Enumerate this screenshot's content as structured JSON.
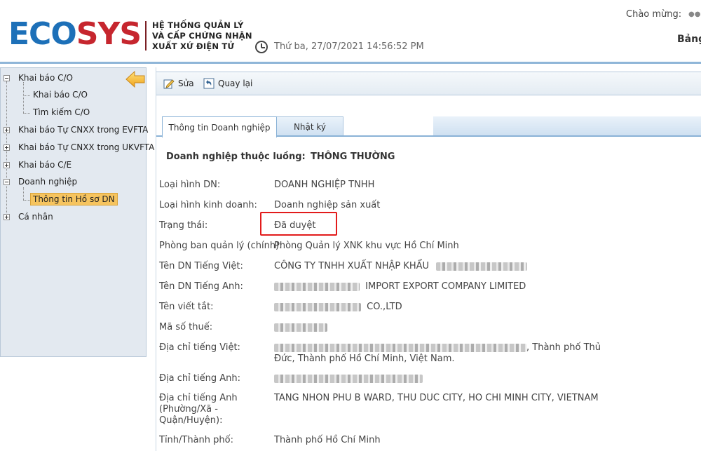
{
  "header": {
    "logo_part1": "ECO",
    "logo_part2": "SYS",
    "tagline_line1": "HỆ THỐNG QUẢN LÝ",
    "tagline_line2": "VÀ CẤP CHỨNG NHẬN",
    "tagline_line3": "XUẤT XỨ ĐIỆN TỬ",
    "datetime": "Thứ ba, 27/07/2021 14:56:52 PM",
    "welcome": "Chào mừng:",
    "dashboard_link": "Bảng"
  },
  "sidebar": {
    "items": [
      {
        "label": "Khai báo C/O"
      },
      {
        "label": "Khai báo C/O"
      },
      {
        "label": "Tìm kiếm C/O"
      },
      {
        "label": "Khai báo Tự CNXX trong EVFTA"
      },
      {
        "label": "Khai báo Tự CNXX trong UKVFTA"
      },
      {
        "label": "Khai báo C/E"
      },
      {
        "label": "Doanh nghiệp"
      },
      {
        "label": "Thông tin Hồ sơ DN"
      },
      {
        "label": "Cá nhân"
      }
    ]
  },
  "toolbar": {
    "edit_label": "Sửa",
    "back_label": "Quay lại"
  },
  "tabs": [
    {
      "label": "Thông tin Doanh nghiệp",
      "active": true
    },
    {
      "label": "Nhật ký",
      "active": false
    }
  ],
  "flow": {
    "label": "Doanh nghiệp thuộc luồng:",
    "value": "THÔNG THƯỜNG"
  },
  "details": {
    "loai_hinh_dn": {
      "label": "Loại hình DN:",
      "value": "DOANH NGHIỆP TNHH"
    },
    "loai_hinh_kd": {
      "label": "Loại hình kinh doanh:",
      "value": "Doanh nghiệp sản xuất"
    },
    "trang_thai": {
      "label": "Trạng thái:",
      "value": "Đã duyệt"
    },
    "phong_ban": {
      "label": "Phòng ban quản lý (chính):",
      "value": "Phòng Quản lý XNK khu vực Hồ Chí Minh"
    },
    "ten_viet": {
      "label": "Tên DN Tiếng Việt:",
      "value": "CÔNG TY TNHH XUẤT NHẬP KHẨU"
    },
    "ten_anh": {
      "label": "Tên DN Tiếng Anh:",
      "value": "IMPORT EXPORT COMPANY LIMITED"
    },
    "ten_tat": {
      "label": "Tên viết tắt:",
      "value": "CO.,LTD"
    },
    "mst": {
      "label": "Mã số thuế:",
      "value": ""
    },
    "dia_chi_viet": {
      "label": "Địa chỉ tiếng Việt:",
      "value_line1": ", Thành phố Thủ",
      "value_line2": "Đức, Thành phố Hồ Chí Minh, Việt Nam."
    },
    "dia_chi_anh": {
      "label": "Địa chỉ tiếng Anh:",
      "value": ""
    },
    "dia_chi_anh_phuong": {
      "label_line1": "Địa chỉ tiếng Anh",
      "label_line2": "(Phường/Xã -",
      "label_line3": "Quận/Huyện):",
      "value": "TANG NHON PHU B WARD, THU DUC CITY, HO CHI MINH CITY, VIETNAM"
    },
    "tinh": {
      "label": "Tỉnh/Thành phố:",
      "value": "Thành phố Hồ Chí Minh"
    }
  },
  "colors": {
    "logo_blue": "#1d70b8",
    "logo_red": "#c6262e",
    "highlight_red": "#e21b1b",
    "selected_item": "#f6c45f"
  }
}
